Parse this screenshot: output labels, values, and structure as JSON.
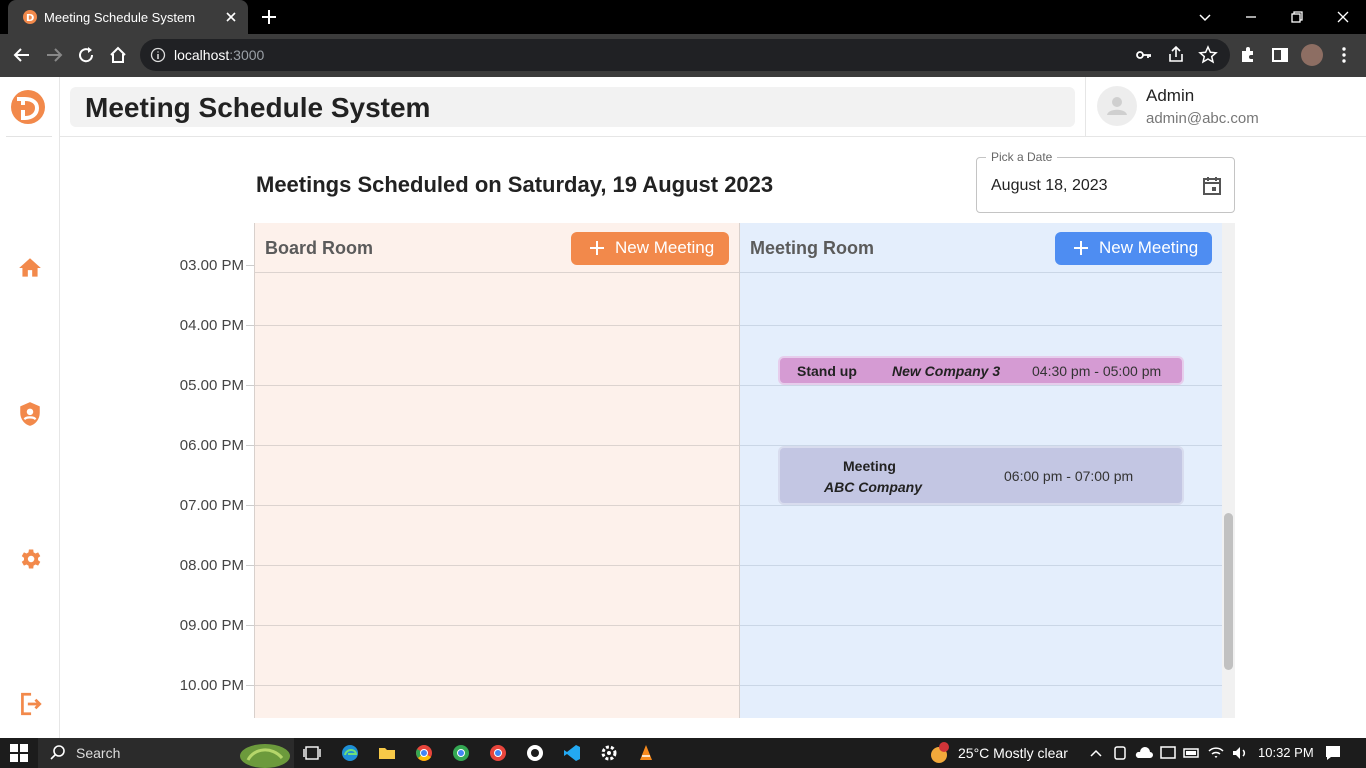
{
  "browser": {
    "tab_title": "Meeting Schedule System",
    "url_host": "localhost",
    "url_port": ":3000"
  },
  "app": {
    "title": "Meeting Schedule System",
    "user": {
      "name": "Admin",
      "email": "admin@abc.com"
    }
  },
  "page": {
    "heading": "Meetings Scheduled on Saturday, 19 August 2023",
    "date_picker": {
      "label": "Pick a Date",
      "value": "August 18, 2023"
    }
  },
  "schedule": {
    "times": [
      "03.00 PM",
      "04.00 PM",
      "05.00 PM",
      "06.00 PM",
      "07.00 PM",
      "08.00 PM",
      "09.00 PM",
      "10.00 PM"
    ],
    "rooms": [
      {
        "name": "Board Room",
        "button": "New Meeting",
        "color": "#f2894b"
      },
      {
        "name": "Meeting Room",
        "button": "New Meeting",
        "color": "#4e8df2"
      }
    ],
    "events": [
      {
        "title": "Stand up",
        "company": "New Company 3",
        "time": "04:30 pm - 05:00 pm",
        "color": "#d59bd3"
      },
      {
        "title": "Meeting",
        "company": "ABC Company",
        "time": "06:00 pm - 07:00 pm",
        "color": "#c3c6e3"
      }
    ]
  },
  "taskbar": {
    "search_placeholder": "Search",
    "weather": "25°C  Mostly clear",
    "time": "10:32 PM"
  }
}
